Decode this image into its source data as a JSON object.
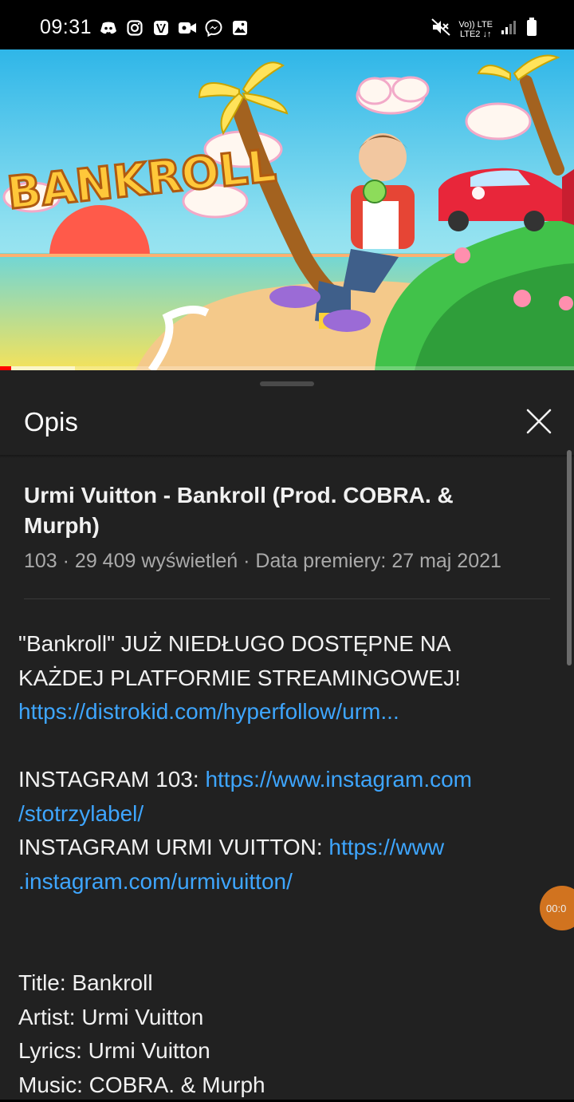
{
  "status_bar": {
    "time": "09:31",
    "notification_icons": [
      "discord-icon",
      "instagram-icon",
      "vinted-icon",
      "video-camera-icon",
      "messenger-icon",
      "gallery-icon"
    ],
    "network_line1": "Vo)) LTE",
    "network_line2": "LTE2 ↓↑",
    "system_icons": [
      "mute-icon",
      "signal-icon",
      "battery-icon"
    ]
  },
  "video": {
    "thumbnail_text": "BANKROLL",
    "progress_fraction": 0.02,
    "buffer_fraction": 0.13
  },
  "panel": {
    "title": "Opis",
    "video_title": "Urmi Vuitton - Bankroll (Prod. COBRA. & Murph)",
    "meta": "103 · 29 409 wyświetleń · Data premiery: 27 maj 2021",
    "description": {
      "line1": "\"Bankroll\" JUŻ NIEDŁUGO DOSTĘPNE NA",
      "line2": "KAŻDEJ PLATFORMIE STREAMINGOWEJ!",
      "link1": "https://distrokid.com/hyperfollow/urm...",
      "ig103_label": "INSTAGRAM 103: ",
      "ig103_link_a": "https://www.instagram.com",
      "ig103_link_b": "/stotrzylabel/",
      "igurmi_label": "INSTAGRAM URMI VUITTON: ",
      "igurmi_link_a": "https://www",
      "igurmi_link_b": ".instagram.com/urmivuitton/",
      "credits": [
        "Title: Bankroll",
        "Artist: Urmi Vuitton",
        "Lyrics: Urmi Vuitton",
        "Music: COBRA. & Murph"
      ]
    },
    "floating_bubble_text": "00:0"
  },
  "colors": {
    "panel_bg": "#212121",
    "link": "#3ea6ff",
    "meta_text": "#aaaaaa",
    "progress": "#ff0000",
    "bubble": "#e07a1f"
  }
}
